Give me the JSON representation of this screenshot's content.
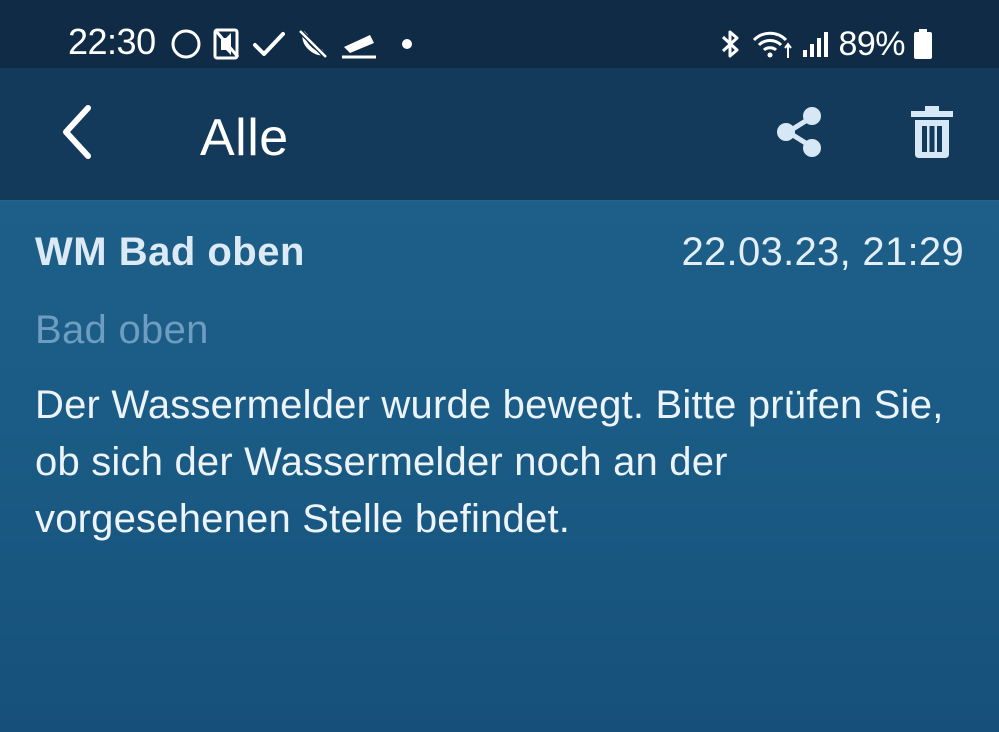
{
  "status_bar": {
    "time": "22:30",
    "battery": "89%",
    "left_icons": [
      "circle-icon",
      "muted-speaker-icon",
      "check-icon",
      "missed-call-icon",
      "cast-icon",
      "dot-icon"
    ],
    "right_icons": [
      "bluetooth-icon",
      "wifi-icon",
      "signal-icon",
      "battery-icon"
    ]
  },
  "app_bar": {
    "title": "Alle",
    "back_icon": "chevron-left-icon",
    "share_icon": "share-icon",
    "delete_icon": "trash-icon"
  },
  "message": {
    "device": "WM Bad oben",
    "timestamp": "22.03.23, 21:29",
    "room": "Bad oben",
    "text": "Der Wassermelder wurde bewegt. Bitte prüfen Sie, ob sich der Wassermelder noch an der vorgesehenen Stelle befindet."
  },
  "colors": {
    "status_bar_bg": "#0f2b45",
    "app_bar_bg": "#133a5a",
    "content_bg": "#1d5f88",
    "room_text": "#6e9dc1",
    "icon_light": "#d6e8f6"
  }
}
